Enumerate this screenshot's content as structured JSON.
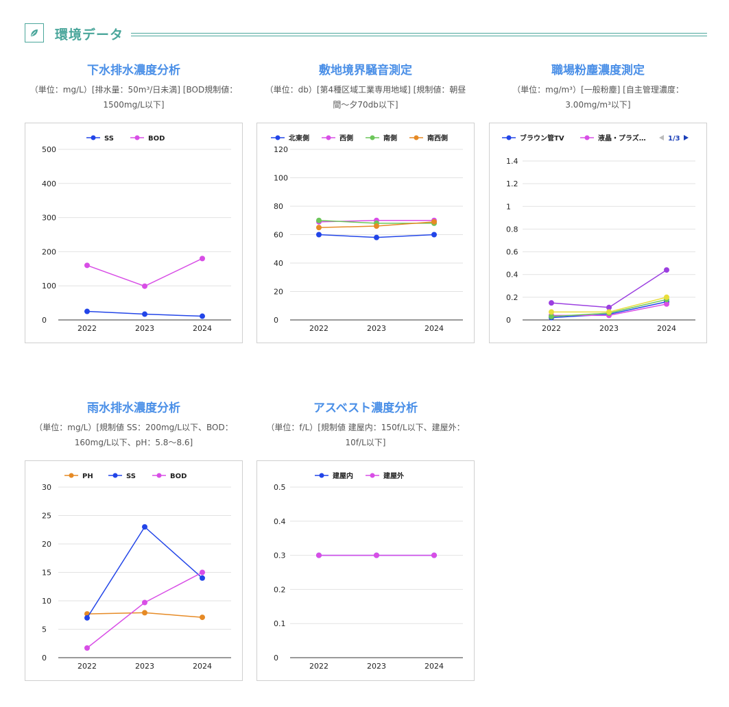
{
  "section": {
    "title": "環境データ",
    "icon": "leaf-icon"
  },
  "colors": {
    "accent": "#4aa69b",
    "chart_title": "#4a8fe7"
  },
  "chart_data": [
    {
      "type": "line",
      "title": "下水排水濃度分析",
      "subtitle": "（単位：mg/L）[排水量：50m³/日未満] [BOD規制値：1500mg/L以下]",
      "x": [
        "2022",
        "2023",
        "2024"
      ],
      "ylim": [
        0,
        500
      ],
      "yticks": [
        "0",
        "100",
        "200",
        "300",
        "400",
        "500"
      ],
      "grid": true,
      "legend": "top",
      "series": [
        {
          "name": "SS",
          "color": "#2245e8",
          "values": [
            25,
            17,
            11
          ]
        },
        {
          "name": "BOD",
          "color": "#d84ee6",
          "values": [
            160,
            99,
            180
          ]
        }
      ]
    },
    {
      "type": "line",
      "title": "敷地境界騒音測定",
      "subtitle": "（単位：db）[第4種区域工業専用地域] [規制値：朝昼間〜夕70db以下]",
      "x": [
        "2022",
        "2023",
        "2024"
      ],
      "ylim": [
        0,
        120
      ],
      "yticks": [
        "0",
        "20",
        "40",
        "60",
        "80",
        "100",
        "120"
      ],
      "grid": true,
      "legend": "top",
      "series": [
        {
          "name": "北東側",
          "color": "#2245e8",
          "values": [
            60,
            58,
            60
          ]
        },
        {
          "name": "西側",
          "color": "#d84ee6",
          "values": [
            69,
            70,
            70
          ]
        },
        {
          "name": "南側",
          "color": "#6cc65a",
          "values": [
            70,
            68,
            68
          ]
        },
        {
          "name": "南西側",
          "color": "#e68a25",
          "values": [
            65,
            66,
            69
          ]
        }
      ]
    },
    {
      "type": "line",
      "title": "職場粉塵濃度測定",
      "subtitle": "（単位：mg/m³）[一般粉塵] [自主管理濃度：3.00mg/m³以下]",
      "x": [
        "2022",
        "2023",
        "2024"
      ],
      "ylim": [
        0,
        1.4
      ],
      "yticks": [
        "0",
        "0.2",
        "0.4",
        "0.6",
        "0.8",
        "1",
        "1.2",
        "1.4"
      ],
      "grid": true,
      "legend": "top",
      "legend_pager": "1/3",
      "series": [
        {
          "name": "ブラウン管TV",
          "color": "#2245e8",
          "values": [
            0.02,
            0.05,
            0.16
          ]
        },
        {
          "name": "液晶・プラズ…",
          "color": "#d84ee6",
          "values": [
            0.04,
            0.04,
            0.14
          ]
        },
        {
          "color": "#9b3fe0",
          "values": [
            0.15,
            0.11,
            0.44
          ]
        },
        {
          "color": "#6cc65a",
          "values": [
            0.03,
            0.06,
            0.18
          ]
        },
        {
          "color": "#e8de3c",
          "values": [
            0.07,
            0.07,
            0.2
          ]
        }
      ]
    },
    {
      "type": "line",
      "title": "雨水排水濃度分析",
      "subtitle": "（単位：mg/L）[規制値 SS：200mg/L以下、BOD：160mg/L以下、pH：5.8〜8.6]",
      "x": [
        "2022",
        "2023",
        "2024"
      ],
      "ylim": [
        0,
        30
      ],
      "yticks": [
        "0",
        "5",
        "10",
        "15",
        "20",
        "25",
        "30"
      ],
      "grid": true,
      "legend": "top",
      "series": [
        {
          "name": "PH",
          "color": "#e68a25",
          "values": [
            7.7,
            7.9,
            7.1
          ]
        },
        {
          "name": "SS",
          "color": "#2245e8",
          "values": [
            7,
            23,
            14
          ]
        },
        {
          "name": "BOD",
          "color": "#d84ee6",
          "values": [
            1.7,
            9.7,
            15
          ]
        }
      ]
    },
    {
      "type": "line",
      "title": "アスベスト濃度分析",
      "subtitle": "（単位：f/L）[規制値 建屋内：150f/L以下、建屋外：10f/L以下]",
      "x": [
        "2022",
        "2023",
        "2024"
      ],
      "ylim": [
        0,
        0.5
      ],
      "yticks": [
        "0",
        "0.1",
        "0.2",
        "0.3",
        "0.4",
        "0.5"
      ],
      "grid": true,
      "legend": "top",
      "series": [
        {
          "name": "建屋内",
          "color": "#2245e8",
          "values": [
            0.3,
            0.3,
            0.3
          ]
        },
        {
          "name": "建屋外",
          "color": "#d84ee6",
          "values": [
            0.3,
            0.3,
            0.3
          ]
        }
      ]
    }
  ]
}
